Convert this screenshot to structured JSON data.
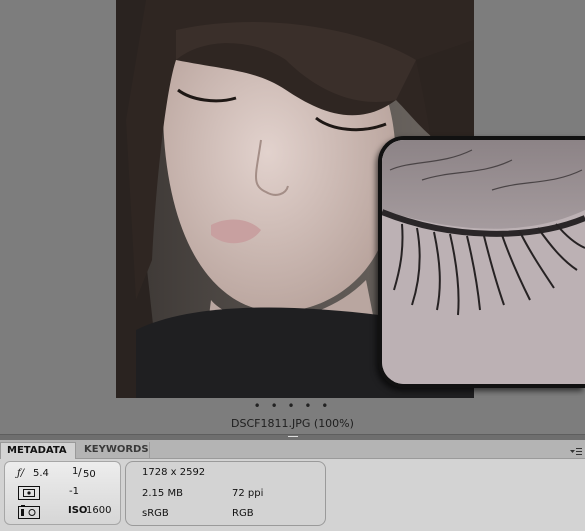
{
  "preview": {
    "thumbnail_dots": "• • • • •",
    "caption": "DSCF1811.JPG (100%)"
  },
  "panel": {
    "tabs": [
      {
        "label": "METADATA",
        "active": true
      },
      {
        "label": "KEYWORDS",
        "active": false
      }
    ],
    "menu_icon": "panel-menu-icon"
  },
  "placard": {
    "aperture": "5.4",
    "aperture_symbol": "ƒ/",
    "shutter_numerator": "1",
    "shutter_denominator": "50",
    "exposure_bias": "-1",
    "iso_label": "ISO",
    "iso_value": "1600",
    "icons": [
      "aperture-icon",
      "metering-icon",
      "white-balance-icon"
    ]
  },
  "file_info": {
    "dimensions": "1728 x 2592",
    "size": "2.15 MB",
    "resolution": "72 ppi",
    "color_profile": "sRGB",
    "color_mode": "RGB"
  },
  "colors": {
    "background": "#7d7d7d",
    "panel": "#d3d3d3",
    "tabbar": "#b4b4b4"
  }
}
